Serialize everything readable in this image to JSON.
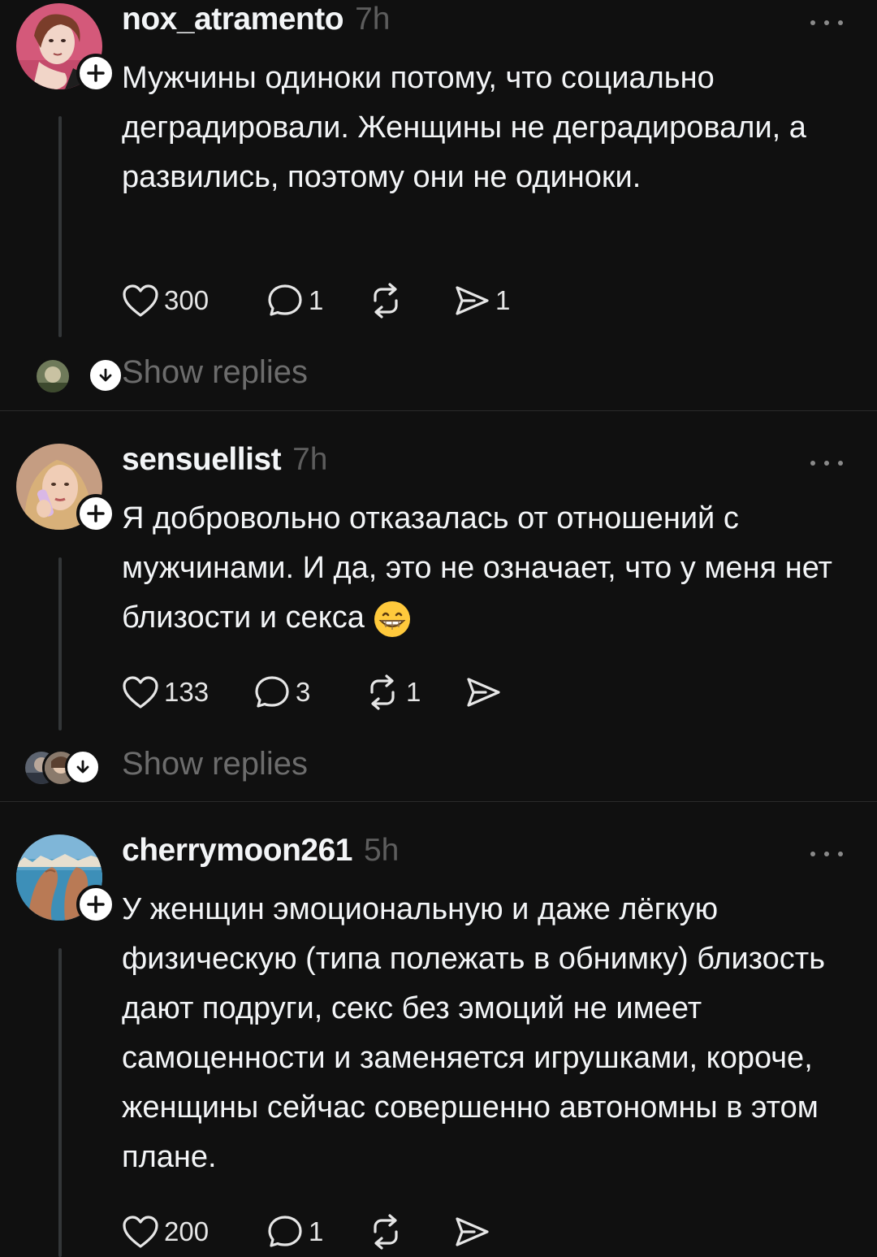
{
  "posts": [
    {
      "username": "nox_atramento",
      "time": "7h",
      "text": "Мужчины одиноки потому, что социально деградировали. Женщины не деградировали, а развились, поэтому они не одиноки.",
      "likes": "300",
      "comments": "1",
      "reposts": "",
      "shares": "1",
      "show_replies": "Show replies"
    },
    {
      "username": "sensuellist",
      "time": "7h",
      "text": "Я добровольно отказалась от отношений с мужчинами. И да, это не означает, что у меня нет близости и секса",
      "emoji": "grinning-face-emoji",
      "likes": "133",
      "comments": "3",
      "reposts": "1",
      "shares": "",
      "show_replies": "Show replies"
    },
    {
      "username": "cherrymoon261",
      "time": "5h",
      "text": "У женщин эмоциональную и даже лёгкую физическую (типа полежать в обнимку) близость дают подруги, секс без эмоций не имеет самоценности и заменяется игрушками, короче, женщины сейчас совершенно автономны в этом плане.",
      "likes": "200",
      "comments": "1",
      "reposts": "",
      "shares": ""
    }
  ],
  "icons": {
    "like": "heart-icon",
    "comment": "speech-bubble-icon",
    "repost": "repost-icon",
    "share": "send-icon",
    "more": "more-dots-icon",
    "follow": "plus-icon",
    "expand": "arrow-down-icon"
  },
  "colors": {
    "background": "#101010",
    "text": "#f3f5f7",
    "muted": "#5d5d5d",
    "divider": "#2a2a2a"
  }
}
